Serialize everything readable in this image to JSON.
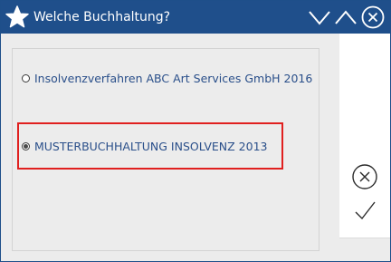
{
  "window": {
    "title": "Welche Buchhaltung?",
    "icons": {
      "app": "star-icon",
      "minimize": "chevron-down-icon",
      "maximize": "chevron-up-icon",
      "close": "close-circle-icon"
    }
  },
  "options": [
    {
      "label": "Insolvenzverfahren ABC Art Services GmbH 2016",
      "selected": false
    },
    {
      "label": "MUSTERBUCHHALTUNG INSOLVENZ 2013",
      "selected": true
    }
  ],
  "actions": {
    "cancel_icon": "cancel-circle-icon",
    "confirm_icon": "checkmark-icon"
  },
  "colors": {
    "titlebar": "#1f4f8b",
    "option_text": "#2a4f8a",
    "highlight_border": "#e0201f"
  }
}
